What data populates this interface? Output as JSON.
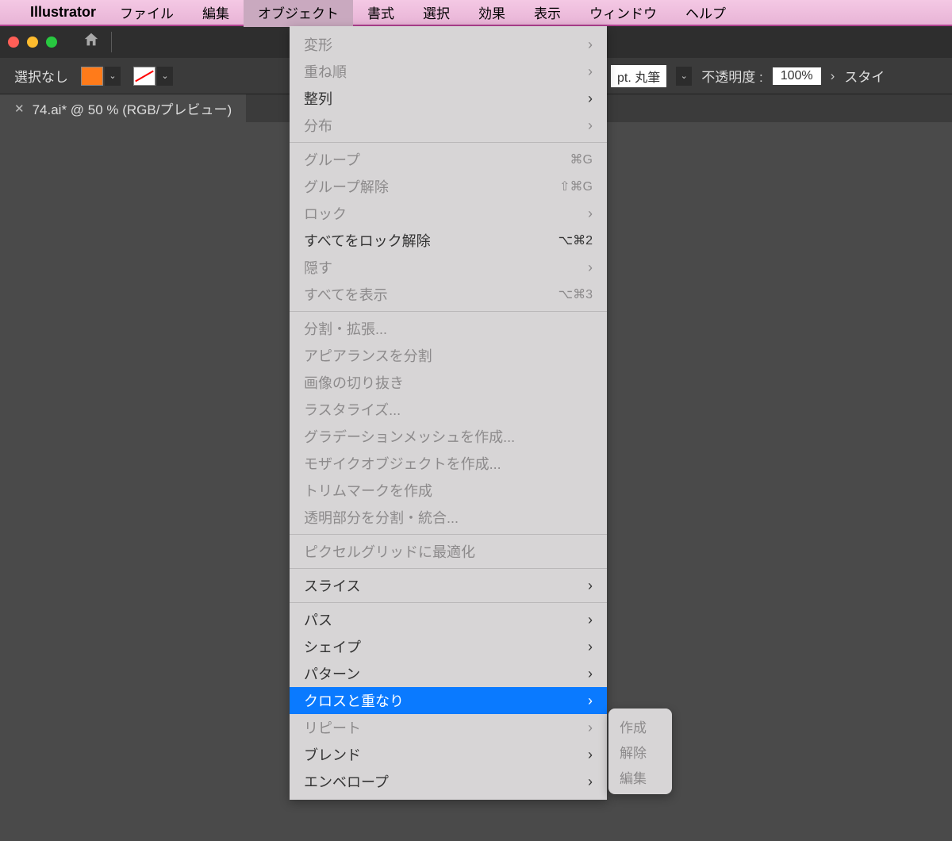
{
  "menubar": {
    "appname": "Illustrator",
    "items": [
      "ファイル",
      "編集",
      "オブジェクト",
      "書式",
      "選択",
      "効果",
      "表示",
      "ウィンドウ",
      "ヘルプ"
    ],
    "active_index": 2
  },
  "optionsbar": {
    "selection": "選択なし",
    "brush": "pt. 丸筆",
    "opacity_label": "不透明度 :",
    "opacity_value": "100%",
    "style_label": "スタイ"
  },
  "tab": {
    "title": "74.ai* @ 50 % (RGB/プレビュー)"
  },
  "object_menu": {
    "sections": [
      [
        {
          "label": "変形",
          "disabled": true,
          "submenu": true
        },
        {
          "label": "重ね順",
          "disabled": true,
          "submenu": true
        },
        {
          "label": "整列",
          "disabled": false,
          "submenu": true
        },
        {
          "label": "分布",
          "disabled": true,
          "submenu": true
        }
      ],
      [
        {
          "label": "グループ",
          "disabled": true,
          "shortcut": "⌘G"
        },
        {
          "label": "グループ解除",
          "disabled": true,
          "shortcut": "⇧⌘G"
        },
        {
          "label": "ロック",
          "disabled": true,
          "submenu": true
        },
        {
          "label": "すべてをロック解除",
          "disabled": false,
          "shortcut": "⌥⌘2"
        },
        {
          "label": "隠す",
          "disabled": true,
          "submenu": true
        },
        {
          "label": "すべてを表示",
          "disabled": true,
          "shortcut": "⌥⌘3"
        }
      ],
      [
        {
          "label": "分割・拡張...",
          "disabled": true
        },
        {
          "label": "アピアランスを分割",
          "disabled": true
        },
        {
          "label": "画像の切り抜き",
          "disabled": true
        },
        {
          "label": "ラスタライズ...",
          "disabled": true
        },
        {
          "label": "グラデーションメッシュを作成...",
          "disabled": true
        },
        {
          "label": "モザイクオブジェクトを作成...",
          "disabled": true
        },
        {
          "label": "トリムマークを作成",
          "disabled": true
        },
        {
          "label": "透明部分を分割・統合...",
          "disabled": true
        }
      ],
      [
        {
          "label": "ピクセルグリッドに最適化",
          "disabled": true
        }
      ],
      [
        {
          "label": "スライス",
          "disabled": false,
          "submenu": true
        }
      ],
      [
        {
          "label": "パス",
          "disabled": false,
          "submenu": true
        },
        {
          "label": "シェイプ",
          "disabled": false,
          "submenu": true
        },
        {
          "label": "パターン",
          "disabled": false,
          "submenu": true
        },
        {
          "label": "クロスと重なり",
          "disabled": false,
          "submenu": true,
          "highlight": true
        },
        {
          "label": "リピート",
          "disabled": true,
          "submenu": true
        },
        {
          "label": "ブレンド",
          "disabled": false,
          "submenu": true
        },
        {
          "label": "エンベロープ",
          "disabled": false,
          "submenu": true
        }
      ]
    ]
  },
  "submenu": {
    "items": [
      "作成",
      "解除",
      "編集"
    ]
  }
}
